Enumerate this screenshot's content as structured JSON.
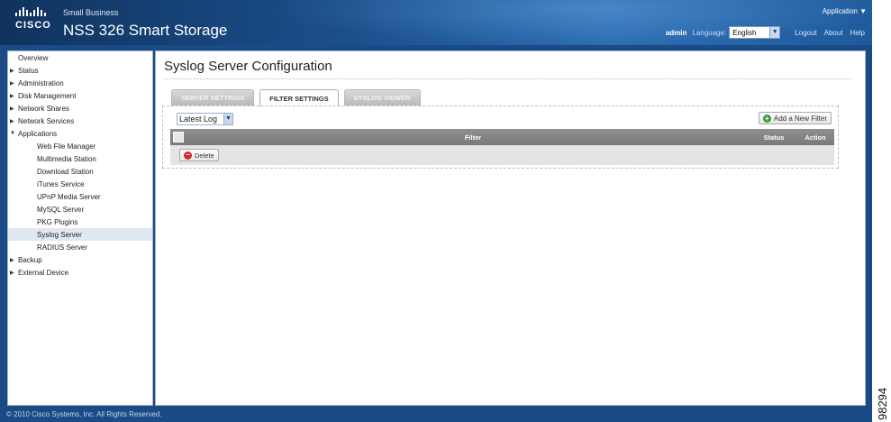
{
  "header": {
    "brand_small": "Small Business",
    "logo_text": "CISCO",
    "product_title": "NSS 326 Smart Storage",
    "app_menu": "Application ▼",
    "user": "admin",
    "language_label": "Language:",
    "language_value": "English",
    "logout": "Logout",
    "about": "About",
    "help": "Help"
  },
  "sidebar": {
    "items": [
      {
        "label": "Overview"
      },
      {
        "label": "Status"
      },
      {
        "label": "Administration"
      },
      {
        "label": "Disk Management"
      },
      {
        "label": "Network Shares"
      },
      {
        "label": "Network Services"
      },
      {
        "label": "Applications"
      },
      {
        "label": "Web File Manager"
      },
      {
        "label": "Multimedia Station"
      },
      {
        "label": "Download Station"
      },
      {
        "label": "iTunes Service"
      },
      {
        "label": "UPnP Media Server"
      },
      {
        "label": "MySQL Server"
      },
      {
        "label": "PKG Plugins"
      },
      {
        "label": "Syslog Server"
      },
      {
        "label": "RADIUS Server"
      },
      {
        "label": "Backup"
      },
      {
        "label": "External Device"
      }
    ]
  },
  "main": {
    "title": "Syslog Server Configuration",
    "tabs": [
      {
        "label": "SERVER SETTINGS"
      },
      {
        "label": "FILTER SETTINGS"
      },
      {
        "label": "SYSLOG VIEWER"
      }
    ],
    "log_select": "Latest Log",
    "add_filter": "Add a New Filter",
    "columns": {
      "filter": "Filter",
      "status": "Status",
      "action": "Action"
    },
    "delete": "Delete"
  },
  "footer": {
    "copyright": "© 2010 Cisco Systems, Inc. All Rights Reserved."
  },
  "figure_number": "98294"
}
